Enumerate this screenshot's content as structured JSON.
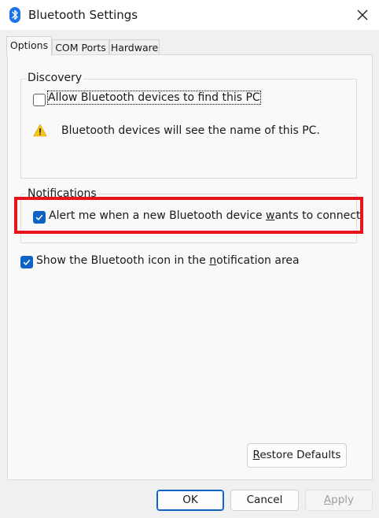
{
  "window": {
    "title": "Bluetooth Settings"
  },
  "tabs": [
    {
      "label": "Options",
      "active": true
    },
    {
      "label": "COM Ports",
      "active": false
    },
    {
      "label": "Hardware",
      "active": false
    }
  ],
  "discovery": {
    "legend": "Discovery",
    "allow_label": "Allow Bluetooth devices to find this PC",
    "allow_checked": false,
    "warning_text": "Bluetooth devices will see the name of this PC."
  },
  "notifications": {
    "legend": "Notifications",
    "alert_label_pre": "Alert me when a new Bluetooth device ",
    "alert_label_accel": "w",
    "alert_label_post": "ants to connect",
    "alert_checked": true
  },
  "tray_icon": {
    "label_pre": "Show the Bluetooth icon in the ",
    "label_accel": "n",
    "label_post": "otification area",
    "checked": true
  },
  "buttons": {
    "restore_accel": "R",
    "restore_rest": "estore Defaults",
    "ok": "OK",
    "cancel": "Cancel",
    "apply_accel": "A",
    "apply_rest": "pply"
  },
  "colors": {
    "accent": "#0f63c6",
    "highlight": "#e8141c",
    "warning": "#f5c518"
  },
  "icons": [
    "bluetooth-icon",
    "close-icon",
    "warning-icon",
    "checkmark-icon"
  ]
}
